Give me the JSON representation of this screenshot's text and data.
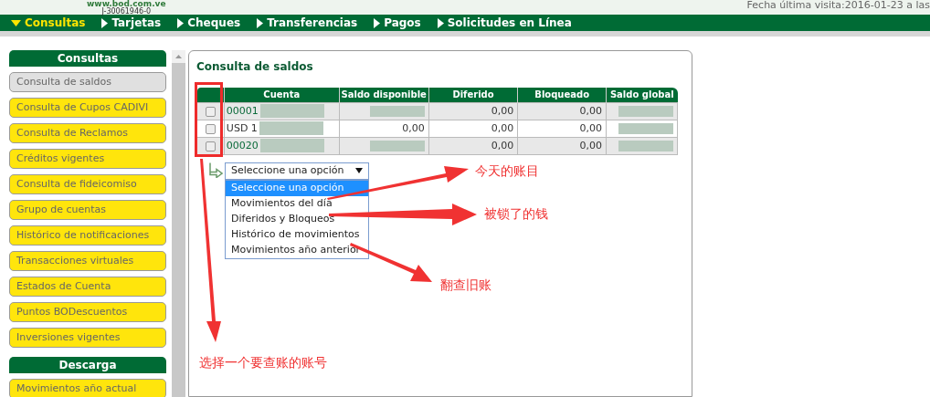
{
  "header": {
    "site": "www.bod.com.ve",
    "rif": "J-30061946-0",
    "last_visit": "Fecha última visita:2016-01-23 a las"
  },
  "nav": [
    {
      "label": "Consultas",
      "selected": true
    },
    {
      "label": "Tarjetas",
      "selected": false
    },
    {
      "label": "Cheques",
      "selected": false
    },
    {
      "label": "Transferencias",
      "selected": false
    },
    {
      "label": "Pagos",
      "selected": false
    },
    {
      "label": "Solicitudes en Línea",
      "selected": false
    }
  ],
  "sidebar": [
    {
      "title": "Consultas",
      "items": [
        {
          "label": "Consulta de saldos",
          "selected": true
        },
        {
          "label": "Consulta de Cupos CADIVI",
          "selected": false
        },
        {
          "label": "Consulta de Reclamos",
          "selected": false
        },
        {
          "label": "Créditos vigentes",
          "selected": false
        },
        {
          "label": "Consulta de fideicomiso",
          "selected": false
        },
        {
          "label": "Grupo de cuentas",
          "selected": false
        },
        {
          "label": "Histórico de notificaciones",
          "selected": false
        },
        {
          "label": "Transacciones virtuales",
          "selected": false
        },
        {
          "label": "Estados de Cuenta",
          "selected": false
        },
        {
          "label": "Puntos BODescuentos",
          "selected": false
        },
        {
          "label": "Inversiones vigentes",
          "selected": false
        }
      ]
    },
    {
      "title": "Descarga",
      "items": [
        {
          "label": "Movimientos año actual",
          "selected": false
        }
      ]
    }
  ],
  "panel": {
    "title": "Consulta de saldos",
    "table": {
      "columns": [
        "Cuenta",
        "Saldo disponible",
        "Diferido",
        "Bloqueado",
        "Saldo global"
      ],
      "rows": [
        {
          "checked": false,
          "link": true,
          "cells": [
            "00001",
            "",
            "0,00",
            "0,00",
            ""
          ]
        },
        {
          "checked": false,
          "link": false,
          "cells": [
            "USD 1",
            "0,00",
            "0,00",
            "0,00",
            ""
          ]
        },
        {
          "checked": false,
          "link": true,
          "cells": [
            "00020",
            "",
            "0,00",
            "0,00",
            ""
          ]
        }
      ]
    },
    "select": {
      "value": "Seleccione una opción",
      "options": [
        {
          "label": "Seleccione una opción",
          "selected": true
        },
        {
          "label": "Movimientos del día",
          "selected": false
        },
        {
          "label": "Diferidos y Bloqueos",
          "selected": false
        },
        {
          "label": "Histórico de movimientos",
          "selected": false
        },
        {
          "label": "Movimientos año anterior",
          "selected": false
        }
      ]
    }
  },
  "annotations": [
    "今天的账目",
    "被锁了的钱",
    "翻查旧账",
    "选择一个要查账的账号"
  ]
}
